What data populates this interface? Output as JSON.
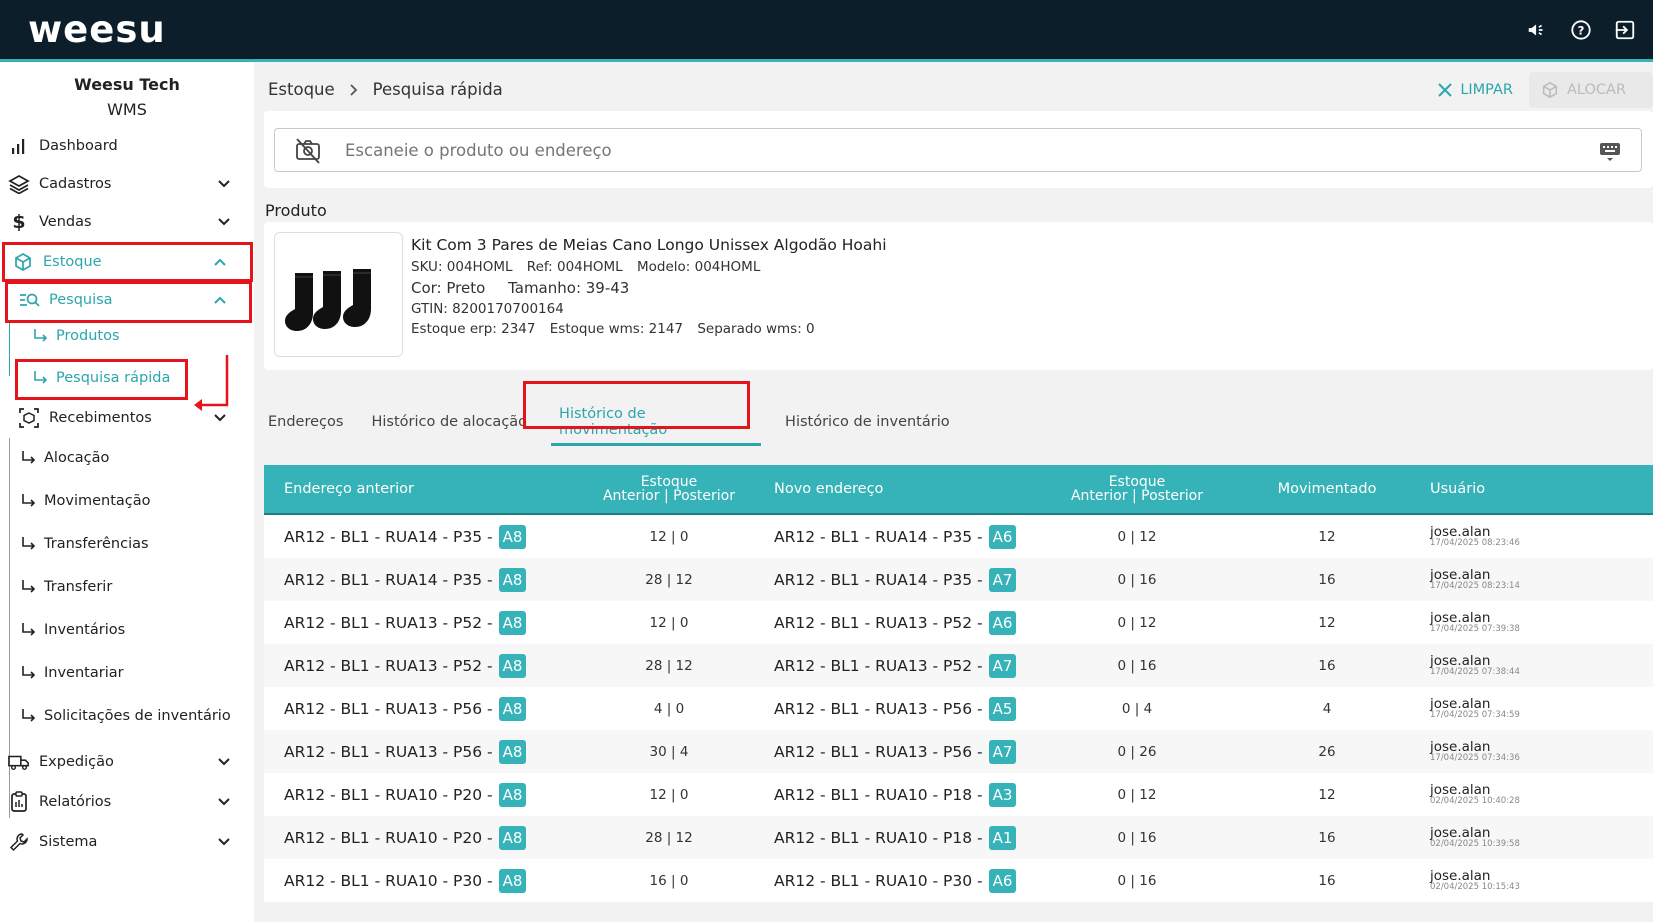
{
  "app": {
    "logo": "weesu",
    "org_name": "Weesu Tech",
    "org_sub": "WMS"
  },
  "colors": {
    "accent": "#35b3b8",
    "topbar": "#0b1e2a",
    "highlight": "#e5141c"
  },
  "top_icons": [
    "megaphone-icon",
    "help-icon",
    "logout-icon"
  ],
  "sidebar": {
    "dashboard": "Dashboard",
    "cadastros": "Cadastros",
    "vendas": "Vendas",
    "estoque": "Estoque",
    "pesquisa": "Pesquisa",
    "produtos": "Produtos",
    "pesquisa_rapida": "Pesquisa rápida",
    "recebimentos": "Recebimentos",
    "alocacao": "Alocação",
    "movimentacao": "Movimentação",
    "transferencias": "Transferências",
    "transferir": "Transferir",
    "inventarios": "Inventários",
    "inventariar": "Inventariar",
    "solicitacoes": "Solicitações de inventário",
    "expedicao": "Expedição",
    "relatorios": "Relatórios",
    "sistema": "Sistema"
  },
  "breadcrumb": [
    "Estoque",
    "Pesquisa rápida"
  ],
  "actions": {
    "clear": "LIMPAR",
    "allocate": "ALOCAR"
  },
  "search": {
    "placeholder": "Escaneie o produto ou endereço"
  },
  "product": {
    "section_label": "Produto",
    "name": "Kit Com 3 Pares de Meias Cano Longo Unissex Algodão Hoahi",
    "sku": "SKU: 004HOML",
    "ref": "Ref: 004HOML",
    "modelo": "Modelo: 004HOML",
    "cor": "Cor: Preto",
    "tamanho": "Tamanho: 39-43",
    "gtin": "GTIN: 8200170700164",
    "estoque_erp": "Estoque erp: 2347",
    "estoque_wms": "Estoque wms: 2147",
    "separado_wms": "Separado wms: 0"
  },
  "tabs": [
    "Endereços",
    "Histórico de alocação",
    "Histórico de movimentação",
    "Histórico de inventário"
  ],
  "table": {
    "headers": {
      "prev_address": "Endereço anterior",
      "stock_title": "Estoque",
      "stock_sub": "Anterior | Posterior",
      "new_address": "Novo endereço",
      "stock_title2": "Estoque",
      "stock_sub2": "Anterior | Posterior",
      "moved": "Movimentado",
      "user": "Usuário"
    },
    "rows": [
      {
        "prev": "AR12 - BL1 - RUA14 - P35 -",
        "prev_badge": "A8",
        "prev_stock": "12 | 0",
        "new": "AR12 - BL1 - RUA14 - P35 -",
        "new_badge": "A6",
        "new_stock": "0 | 12",
        "moved": "12",
        "user": "jose.alan",
        "date": "17/04/2025 08:23:46"
      },
      {
        "prev": "AR12 - BL1 - RUA14 - P35 -",
        "prev_badge": "A8",
        "prev_stock": "28 | 12",
        "new": "AR12 - BL1 - RUA14 - P35 -",
        "new_badge": "A7",
        "new_stock": "0 | 16",
        "moved": "16",
        "user": "jose.alan",
        "date": "17/04/2025 08:23:14"
      },
      {
        "prev": "AR12 - BL1 - RUA13 - P52 -",
        "prev_badge": "A8",
        "prev_stock": "12 | 0",
        "new": "AR12 - BL1 - RUA13 - P52 -",
        "new_badge": "A6",
        "new_stock": "0 | 12",
        "moved": "12",
        "user": "jose.alan",
        "date": "17/04/2025 07:39:38"
      },
      {
        "prev": "AR12 - BL1 - RUA13 - P52 -",
        "prev_badge": "A8",
        "prev_stock": "28 | 12",
        "new": "AR12 - BL1 - RUA13 - P52 -",
        "new_badge": "A7",
        "new_stock": "0 | 16",
        "moved": "16",
        "user": "jose.alan",
        "date": "17/04/2025 07:38:44"
      },
      {
        "prev": "AR12 - BL1 - RUA13 - P56 -",
        "prev_badge": "A8",
        "prev_stock": "4 | 0",
        "new": "AR12 - BL1 - RUA13 - P56 -",
        "new_badge": "A5",
        "new_stock": "0 | 4",
        "moved": "4",
        "user": "jose.alan",
        "date": "17/04/2025 07:34:59"
      },
      {
        "prev": "AR12 - BL1 - RUA13 - P56 -",
        "prev_badge": "A8",
        "prev_stock": "30 | 4",
        "new": "AR12 - BL1 - RUA13 - P56 -",
        "new_badge": "A7",
        "new_stock": "0 | 26",
        "moved": "26",
        "user": "jose.alan",
        "date": "17/04/2025 07:34:36"
      },
      {
        "prev": "AR12 - BL1 - RUA10 - P20 -",
        "prev_badge": "A8",
        "prev_stock": "12 | 0",
        "new": "AR12 - BL1 - RUA10 - P18 -",
        "new_badge": "A3",
        "new_stock": "0 | 12",
        "moved": "12",
        "user": "jose.alan",
        "date": "02/04/2025 10:40:28"
      },
      {
        "prev": "AR12 - BL1 - RUA10 - P20 -",
        "prev_badge": "A8",
        "prev_stock": "28 | 12",
        "new": "AR12 - BL1 - RUA10 - P18 -",
        "new_badge": "A1",
        "new_stock": "0 | 16",
        "moved": "16",
        "user": "jose.alan",
        "date": "02/04/2025 10:39:58"
      },
      {
        "prev": "AR12 - BL1 - RUA10 - P30 -",
        "prev_badge": "A8",
        "prev_stock": "16 | 0",
        "new": "AR12 - BL1 - RUA10 - P30 -",
        "new_badge": "A6",
        "new_stock": "0 | 16",
        "moved": "16",
        "user": "jose.alan",
        "date": "02/04/2025 10:15:43"
      }
    ]
  }
}
